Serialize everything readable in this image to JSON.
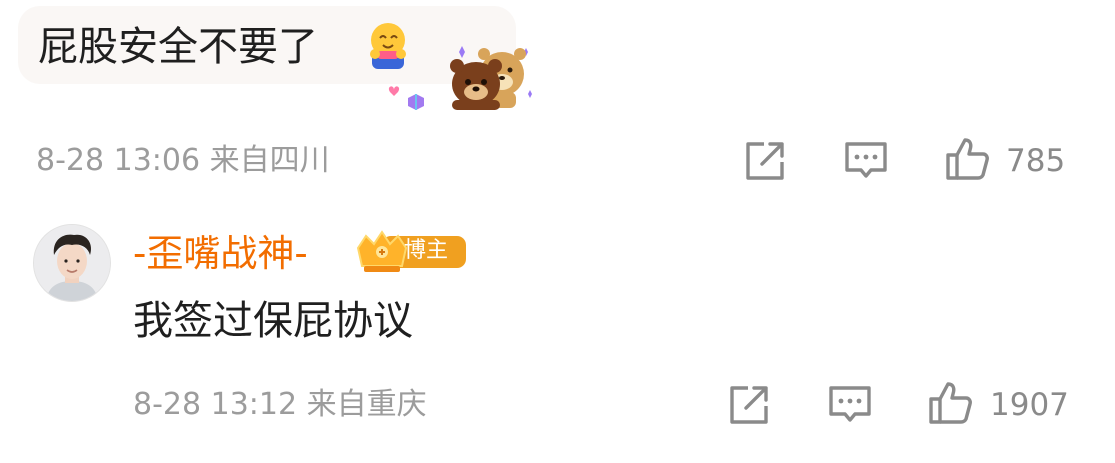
{
  "comment1": {
    "text": "屁股安全不要了",
    "emoji": "hug-emoji",
    "sticker": "bear-duo-sticker",
    "time": "8-28 13:06",
    "location": "来自四川",
    "like_count": "785"
  },
  "reply": {
    "username": "-歪嘴战神-",
    "badge_label": "博主",
    "text": "我签过保屁协议",
    "time": "8-28 13:12",
    "location": "来自重庆",
    "like_count": "1907"
  },
  "icons": {
    "share": "share-icon",
    "comment": "comment-icon",
    "like": "thumbs-up-icon"
  },
  "colors": {
    "username": "#f26d00",
    "meta": "#9c9c9c",
    "badge": "#f0a020"
  }
}
